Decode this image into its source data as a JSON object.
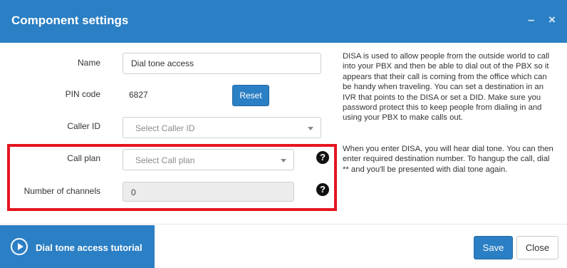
{
  "dialog": {
    "title": "Component settings",
    "minimize_glyph": "–",
    "close_glyph": "×"
  },
  "form": {
    "name_label": "Name",
    "name_value": "Dial tone access",
    "pin_label": "PIN code",
    "pin_value": "6827",
    "reset_label": "Reset",
    "caller_id_label": "Caller ID",
    "caller_id_placeholder": "Select Caller ID",
    "call_plan_label": "Call plan",
    "call_plan_placeholder": "Select Call plan",
    "channels_label": "Number of channels",
    "channels_value": "0",
    "help_glyph": "?"
  },
  "description": {
    "paragraph_1": "DISA is used to allow people from the outside world to call into your PBX and then be able to dial out of the PBX so it appears that their call is coming from the office which can be handy when traveling. You can set a destination in an IVR that points to the DISA or set a DID. Make sure you password protect this to keep people from dialing in and using your PBX to make calls out.",
    "paragraph_2": "When you enter DISA, you will hear dial tone. You can then enter required destination number. To hangup the call, dial ** and you'll be presented with dial tone again."
  },
  "footer": {
    "tutorial_label": "Dial tone access tutorial",
    "save_label": "Save",
    "close_label": "Close"
  },
  "colors": {
    "accent": "#2b7fc4",
    "highlight": "#e4151f"
  },
  "icons": {
    "play": "play-circle-icon",
    "help": "question-circle-icon",
    "caret": "caret-down-icon"
  }
}
